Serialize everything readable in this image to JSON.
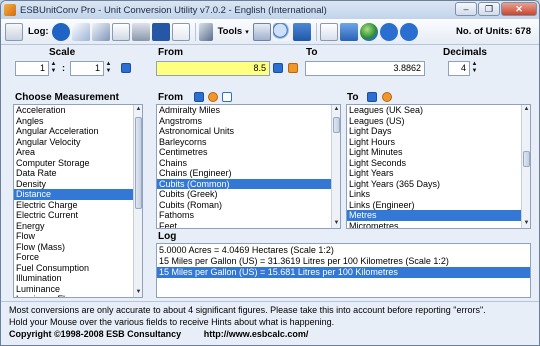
{
  "window": {
    "title": "ESBUnitConv Pro - Unit Conversion Utility v7.0.2 - English (International)",
    "minimize_glyph": "–",
    "restore_glyph": "❐",
    "close_glyph": "✕"
  },
  "toolbar": {
    "log_label": "Log:",
    "tools_label": "Tools",
    "units_label": "No. of Units: 678"
  },
  "scale": {
    "header": "Scale",
    "left_value": "1",
    "separator": ":",
    "right_value": "1"
  },
  "conversion": {
    "from_header": "From",
    "to_header": "To",
    "decimals_header": "Decimals",
    "from_value": "8.5",
    "to_value": "3.8862",
    "decimals_value": "4"
  },
  "measurement": {
    "header": "Choose Measurement",
    "items": [
      "Acceleration",
      "Angles",
      "Angular Acceleration",
      "Angular Velocity",
      "Area",
      "Computer Storage",
      "Data Rate",
      "Density",
      "Distance",
      "Electric Charge",
      "Electric Current",
      "Energy",
      "Flow",
      "Flow (Mass)",
      "Force",
      "Fuel Consumption",
      "Illumination",
      "Luminance",
      "Luminous Flux"
    ],
    "selected": "Distance"
  },
  "from_list": {
    "header": "From",
    "items": [
      "Admiralty Miles",
      "Angstroms",
      "Astronomical Units",
      "Barleycorns",
      "Centimetres",
      "Chains",
      "Chains (Engineer)",
      "Cubits (Common)",
      "Cubits (Greek)",
      "Cubits (Roman)",
      "Fathoms",
      "Feet"
    ],
    "selected": "Cubits (Common)"
  },
  "to_list": {
    "header": "To",
    "items": [
      "Leagues (UK Sea)",
      "Leagues (US)",
      "Light Days",
      "Light Hours",
      "Light Minutes",
      "Light Seconds",
      "Light Years",
      "Light Years (365 Days)",
      "Links",
      "Links (Engineer)",
      "Metres",
      "Micrometres"
    ],
    "selected": "Metres"
  },
  "log": {
    "header": "Log",
    "entries": [
      "5.0000 Acres = 4.0469 Hectares (Scale 1:2)",
      "15 Miles per Gallon (US) = 31.3619 Litres per 100 Kilometres (Scale 1:2)",
      "15 Miles per Gallon (US) = 15.681 Litres per 100 Kilometres"
    ],
    "selected_index": 2
  },
  "footer": {
    "line1": "Most conversions are only accurate to about 4 significant figures. Please take this into account before reporting \"errors\".",
    "line2": "Hold your Mouse over the various fields to receive Hints about what is happening.",
    "copyright": "Copyright ©1998-2008  ESB Consultancy",
    "url": "http://www.esbcalc.com/"
  },
  "colors": {
    "accent": "#3478d6",
    "from_field_bg": "#ffff80"
  }
}
